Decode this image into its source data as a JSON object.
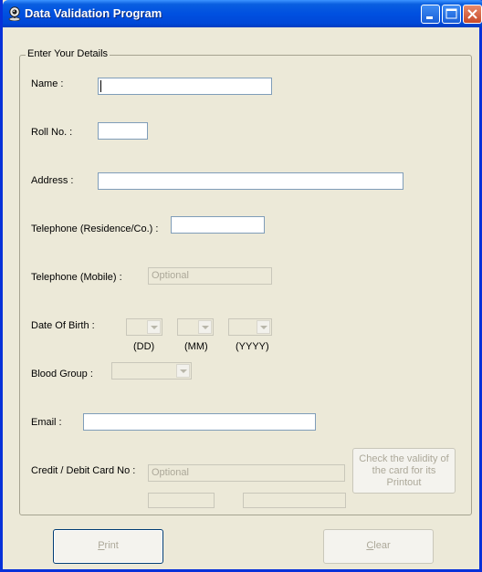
{
  "window": {
    "title": "Data Validation Program",
    "icon": "webcam-icon"
  },
  "form": {
    "group_title": "Enter Your Details",
    "name_label": "Name  :",
    "name_value": "",
    "roll_label": "Roll No.  :",
    "roll_value": "",
    "address_label": "Address  :",
    "address_value": "",
    "telephone_res_label": "Telephone (Residence/Co.)  :",
    "telephone_res_value": "",
    "telephone_mobile_label": "Telephone (Mobile)  :",
    "telephone_mobile_placeholder": "Optional",
    "dob_label": "Date Of Birth  :",
    "dob_dd_caption": "(DD)",
    "dob_mm_caption": "(MM)",
    "dob_yyyy_caption": "(YYYY)",
    "blood_group_label": "Blood Group  :",
    "email_label": "Email  :",
    "email_value": "",
    "card_label": "Credit / Debit Card No :",
    "card_placeholder": "Optional",
    "check_button_label": "Check the validity of the card for its Printout"
  },
  "buttons": {
    "print_label_accel": "P",
    "print_label_rest": "rint",
    "clear_label_accel": "C",
    "clear_label_rest": "lear"
  },
  "colors": {
    "titlebar": "#0050e0",
    "window_bg": "#ece9d8",
    "disabled_text": "#aca899"
  }
}
